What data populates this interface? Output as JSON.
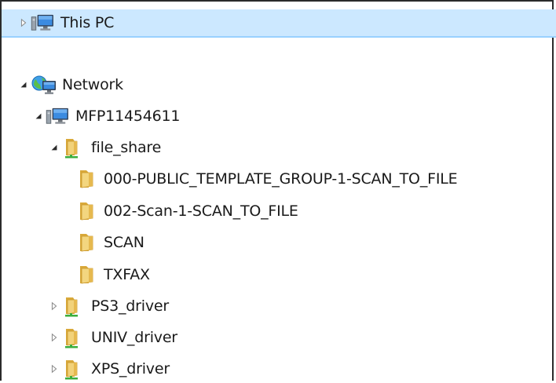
{
  "tree": {
    "this_pc": {
      "label": "This PC",
      "icon": "computer-icon",
      "toggle": "expand-arrow-icon"
    },
    "network": {
      "label": "Network",
      "icon": "network-globe-icon",
      "toggle": "collapse-arrow-icon"
    },
    "device": {
      "label": "MFP11454611",
      "icon": "computer-icon",
      "toggle": "collapse-arrow-icon"
    },
    "file_share": {
      "label": "file_share",
      "icon": "shared-folder-icon",
      "toggle": "collapse-arrow-icon",
      "children": [
        {
          "label": "000-PUBLIC_TEMPLATE_GROUP-1-SCAN_TO_FILE",
          "icon": "folder-icon"
        },
        {
          "label": "002-Scan-1-SCAN_TO_FILE",
          "icon": "folder-icon"
        },
        {
          "label": "SCAN",
          "icon": "folder-icon"
        },
        {
          "label": "TXFAX",
          "icon": "folder-icon"
        }
      ]
    },
    "shares": [
      {
        "label": "PS3_driver",
        "icon": "shared-folder-icon",
        "toggle": "expand-arrow-icon"
      },
      {
        "label": "UNIV_driver",
        "icon": "shared-folder-icon",
        "toggle": "expand-arrow-icon"
      },
      {
        "label": "XPS_driver",
        "icon": "shared-folder-icon",
        "toggle": "expand-arrow-icon"
      }
    ]
  },
  "colors": {
    "selection_bg": "#cce8ff",
    "selection_border": "#99d1ff",
    "folder": "#e8c25a",
    "share_green": "#3cae3c",
    "monitor_blue": "#2f6fd0"
  }
}
